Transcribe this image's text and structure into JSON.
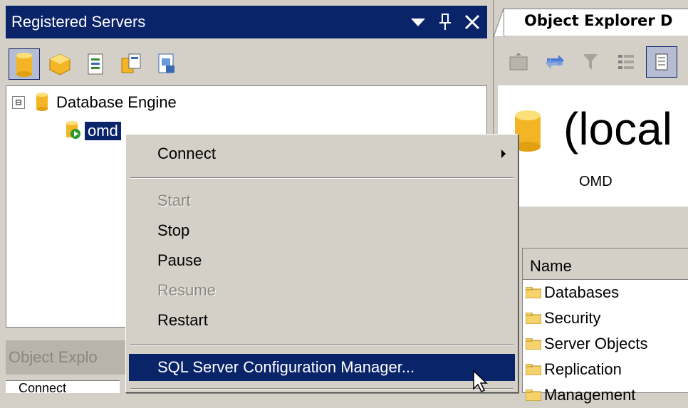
{
  "registered_servers": {
    "title": "Registered Servers",
    "tree": {
      "root_label": "Database Engine",
      "expander": "⊟",
      "server_label": "omd"
    },
    "bottom_tab": "Object Explo",
    "bottom_strip_text": "Connect"
  },
  "object_explorer": {
    "tab_label": "Object Explorer D",
    "server_name": "(local",
    "server_subtitle": "OMD",
    "list_header": "Name",
    "items": [
      "Databases",
      "Security",
      "Server Objects",
      "Replication",
      "Management"
    ]
  },
  "context_menu": {
    "items": [
      {
        "label": "Connect",
        "has_submenu": true
      },
      {
        "label": "Start",
        "disabled": true
      },
      {
        "label": "Stop"
      },
      {
        "label": "Pause"
      },
      {
        "label": "Resume",
        "disabled": true
      },
      {
        "label": "Restart"
      },
      {
        "label": "SQL Server Configuration Manager...",
        "highlighted": true
      }
    ]
  },
  "colors": {
    "titlebar": "#0a246a",
    "face": "#d4d0c8",
    "disabled_text": "#8a877f",
    "folder": "#f6d36a"
  },
  "icons": {
    "title_dropdown": "chevron-down-icon",
    "title_pin": "pin-icon",
    "title_close": "close-icon"
  }
}
